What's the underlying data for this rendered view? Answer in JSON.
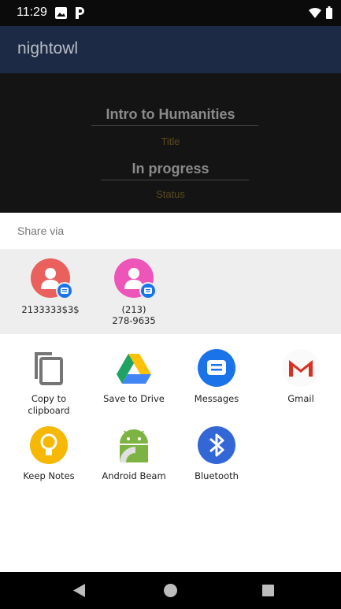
{
  "status_bar": {
    "time": "11:29"
  },
  "app_bar": {
    "title": "nightowl"
  },
  "course": {
    "name": "Intro to Humanities",
    "name_label": "Title",
    "status": "In progress",
    "status_label": "Status"
  },
  "share_sheet": {
    "title": "Share via",
    "direct_targets": [
      {
        "label": "2133333$3$",
        "avatar_color": "#e9605c"
      },
      {
        "label": "(213)\n278-9635",
        "avatar_color": "#ee55b8"
      }
    ],
    "apps": [
      {
        "label": "Copy to\nclipboard",
        "icon": "copy-icon"
      },
      {
        "label": "Save to Drive",
        "icon": "drive-icon"
      },
      {
        "label": "Messages",
        "icon": "messages-icon"
      },
      {
        "label": "Gmail",
        "icon": "gmail-icon"
      },
      {
        "label": "Keep Notes",
        "icon": "keep-icon"
      },
      {
        "label": "Android Beam",
        "icon": "android-icon"
      },
      {
        "label": "Bluetooth",
        "icon": "bluetooth-icon"
      }
    ]
  },
  "colors": {
    "accent": "#1a73e8",
    "app_bar": "#1d2a45",
    "sheet_bg": "#ffffff"
  }
}
